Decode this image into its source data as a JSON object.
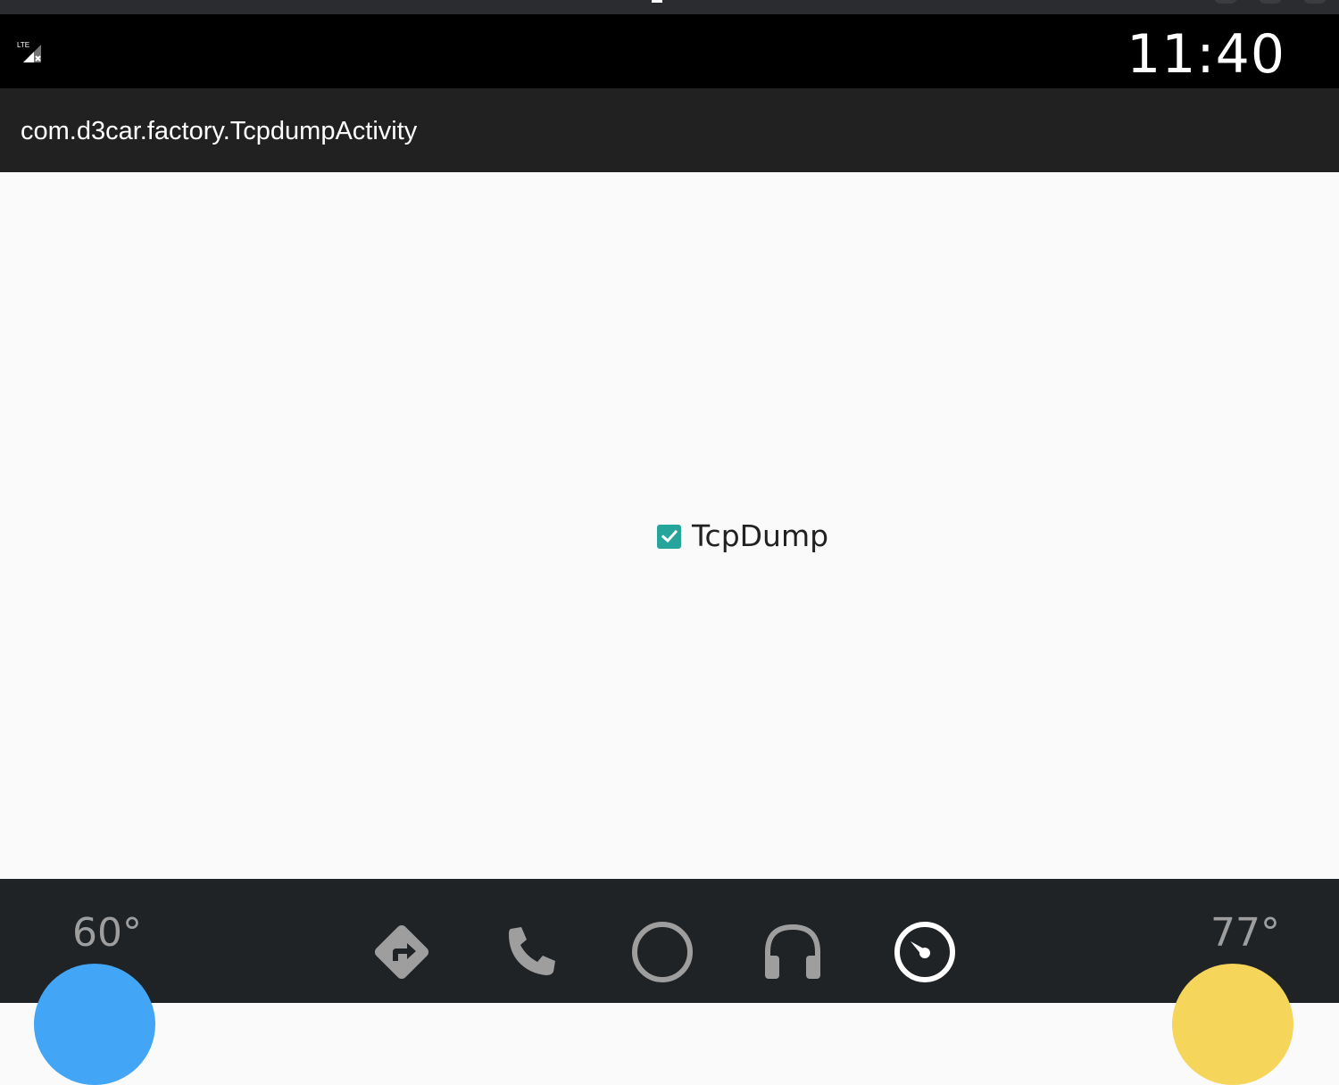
{
  "status_bar": {
    "time": "11:40",
    "signal_icon": "lte-no-signal-icon"
  },
  "app_bar": {
    "title": "com.d3car.factory.TcpdumpActivity"
  },
  "content": {
    "checkbox": {
      "label": "TcpDump",
      "checked": true
    }
  },
  "nav_bar": {
    "left_temp": "60°",
    "right_temp": "77°",
    "icons": [
      "navigation-icon",
      "phone-icon",
      "home-icon",
      "headphones-icon",
      "dashboard-icon"
    ]
  },
  "colors": {
    "accent": "#26a69a",
    "left_knob": "#42a5f5",
    "right_knob": "#f5d65b",
    "app_bar": "#212121",
    "nav_bar": "#1f2326",
    "icon_gray": "#9e9e9e"
  }
}
